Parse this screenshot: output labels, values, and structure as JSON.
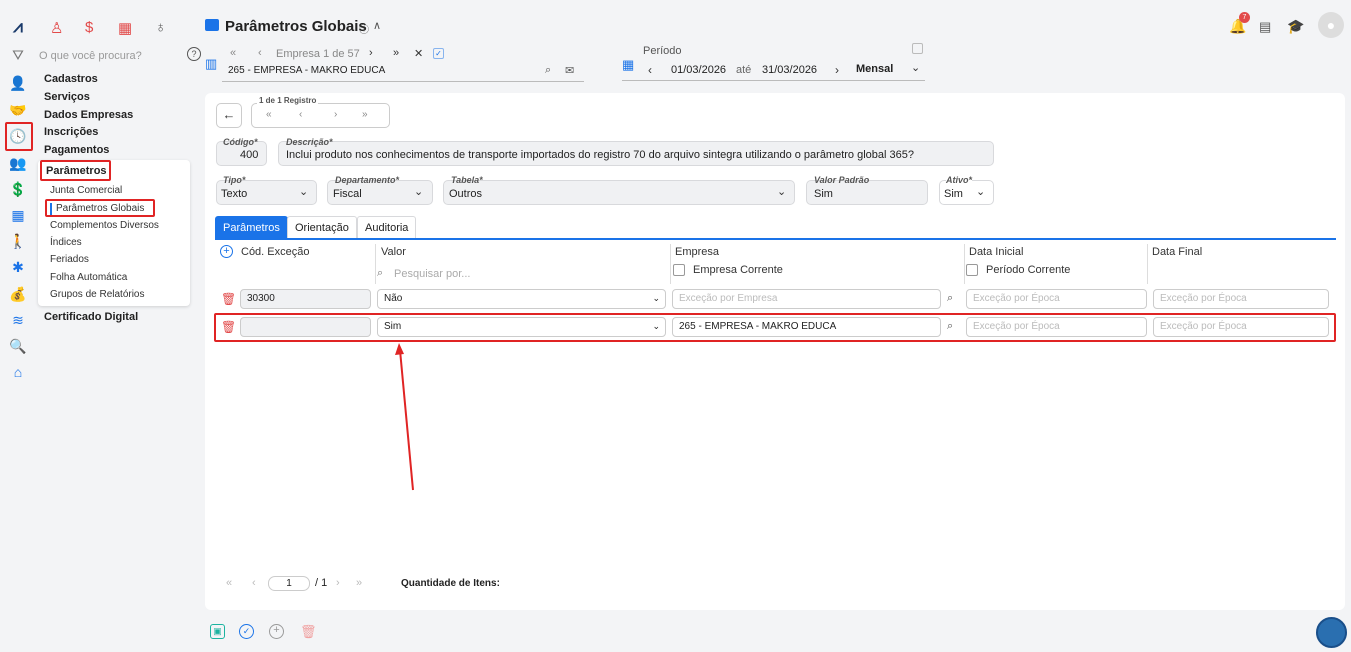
{
  "header": {
    "title": "Parâmetros Globais",
    "empresa_nav": "Empresa 1 de 57",
    "empresa_value": "265 - EMPRESA - MAKRO EDUCA",
    "periodo_label": "Período",
    "periodo_inicio": "01/03/2026",
    "ate": "até",
    "periodo_fim": "31/03/2026",
    "periodo_tipo": "Mensal",
    "notification_count": "7"
  },
  "nav": {
    "search_placeholder": "O que você procura?",
    "items": [
      "Cadastros",
      "Serviços",
      "Dados Empresas",
      "Inscrições",
      "Pagamentos",
      "Parâmetros",
      "Certificado Digital"
    ],
    "sub_items": [
      "Junta Comercial",
      "Parâmetros Globais",
      "Complementos Diversos",
      "Índices",
      "Feriados",
      "Folha Automática",
      "Grupos de Relatórios"
    ]
  },
  "record": {
    "nav_label": "1 de 1 Registro",
    "codigo_label": "Código*",
    "codigo": "400",
    "descricao_label": "Descrição*",
    "descricao": "Inclui produto nos conhecimentos de transporte importados do registro 70 do arquivo sintegra utilizando o parâmetro global 365?",
    "tipo_label": "Tipo*",
    "tipo": "Texto",
    "departamento_label": "Departamento*",
    "departamento": "Fiscal",
    "tabela_label": "Tabela*",
    "tabela": "Outros",
    "valor_padrao_label": "Valor Padrão",
    "valor_padrao": "Sim",
    "ativo_label": "Ativo*",
    "ativo": "Sim"
  },
  "tabs": [
    "Parâmetros",
    "Orientação",
    "Auditoria"
  ],
  "grid": {
    "headers": {
      "cod": "Cód. Exceção",
      "valor": "Valor",
      "empresa": "Empresa",
      "data_inicial": "Data Inicial",
      "data_final": "Data Final"
    },
    "search_placeholder": "Pesquisar por...",
    "empresa_corrente": "Empresa Corrente",
    "periodo_corrente": "Período Corrente",
    "placeholder_empresa": "Exceção por Empresa",
    "placeholder_epoca": "Exceção por Época",
    "rows": [
      {
        "cod": "30300",
        "valor": "Não",
        "empresa": ""
      },
      {
        "cod": "",
        "valor": "Sim",
        "empresa": "265 - EMPRESA - MAKRO EDUCA"
      }
    ]
  },
  "pager": {
    "page": "1",
    "total": "/ 1",
    "qtd_label": "Quantidade de Itens:"
  },
  "colors": {
    "accent": "#1a73e8",
    "highlight": "#e02424",
    "teal": "#1bb3a0"
  }
}
